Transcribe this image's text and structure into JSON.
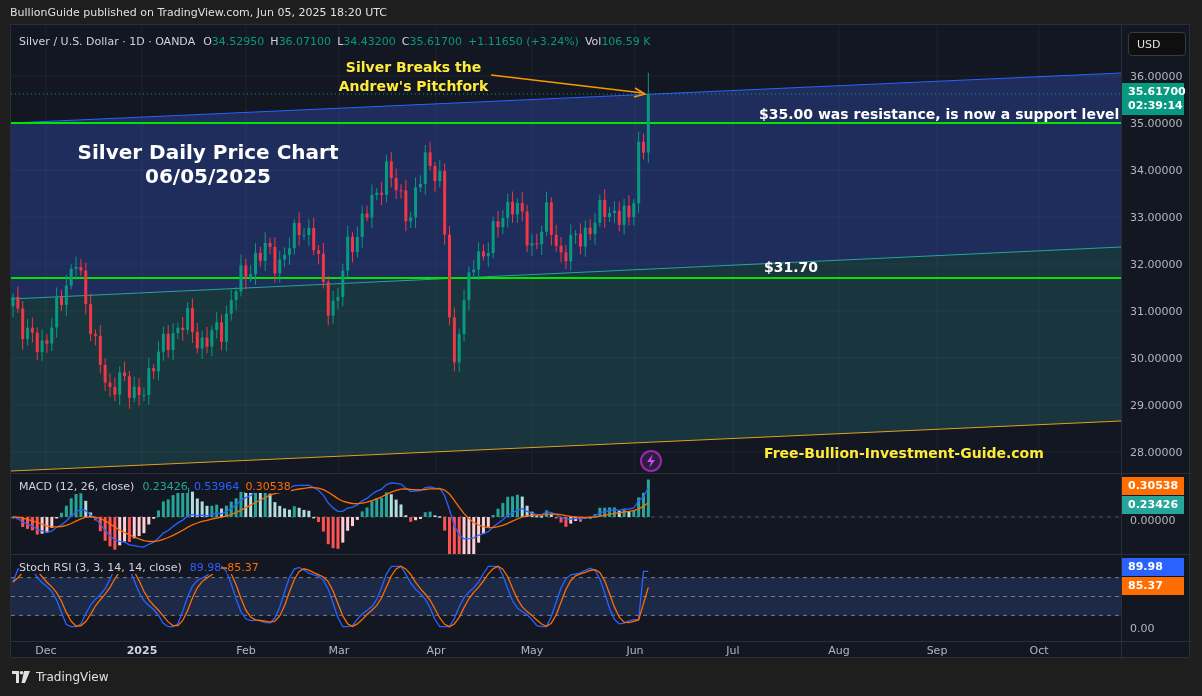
{
  "publisher": "BullionGuide published on TradingView.com, Jun 05, 2025 18:20 UTC",
  "legend": {
    "symbol": "Silver / U.S. Dollar · 1D · OANDA",
    "ohlc": [
      {
        "label": "O",
        "value": "34.52950"
      },
      {
        "label": "H",
        "value": "36.07100"
      },
      {
        "label": "L",
        "value": "34.43200"
      },
      {
        "label": "C",
        "value": "35.61700"
      }
    ],
    "change": "+1.11650 (+3.24%)",
    "volume": {
      "label": "Vol",
      "value": "106.59 K"
    }
  },
  "currency": "USD",
  "price_axis": {
    "ticks": [
      "36.00000",
      "35.00000",
      "34.00000",
      "33.00000",
      "32.00000",
      "31.00000",
      "30.00000",
      "29.00000",
      "28.00000"
    ],
    "last_price": "35.61700",
    "countdown": "02:39:14"
  },
  "annotation": [
    "Silver Breaks the",
    "Andrew's Pitchfork"
  ],
  "title": [
    "Silver Daily Price Chart",
    "06/05/2025"
  ],
  "levels": [
    {
      "label": "$35.00 was resistance, is now a support level"
    },
    {
      "label": "$31.70"
    }
  ],
  "website": "Free-Bullion-Investment-Guide.com",
  "macd": {
    "title": "MACD (12, 26, close)",
    "values": [
      {
        "text": "0.23426",
        "color": "#26a69a"
      },
      {
        "text": "0.53964",
        "color": "#2962ff"
      },
      {
        "text": "0.30538",
        "color": "#ff6d00"
      }
    ],
    "axis_tick": "0.00000",
    "badges": [
      {
        "text": "0.30538",
        "color": "#ff6d00"
      },
      {
        "text": "0.23426",
        "color": "#26a69a"
      }
    ]
  },
  "stoch_rsi": {
    "title": "Stoch RSI (3, 3, 14, 14, close)",
    "values": [
      {
        "text": "89.98",
        "color": "#2962ff"
      },
      {
        "text": "85.37",
        "color": "#ff6d00"
      }
    ],
    "axis_tick": "0.00",
    "badges": [
      {
        "text": "89.98",
        "color": "#2962ff"
      },
      {
        "text": "85.37",
        "color": "#ff6d00"
      }
    ]
  },
  "time_axis": [
    {
      "label": "Dec",
      "kind": "month"
    },
    {
      "label": "2025",
      "kind": "year"
    },
    {
      "label": "Feb",
      "kind": "month"
    },
    {
      "label": "Mar",
      "kind": "month"
    },
    {
      "label": "Apr",
      "kind": "month"
    },
    {
      "label": "May",
      "kind": "month"
    },
    {
      "label": "Jun",
      "kind": "month"
    },
    {
      "label": "Jul",
      "kind": "month"
    },
    {
      "label": "Aug",
      "kind": "month"
    },
    {
      "label": "Sep",
      "kind": "month"
    },
    {
      "label": "Oct",
      "kind": "month"
    }
  ],
  "footer": "TradingView"
}
